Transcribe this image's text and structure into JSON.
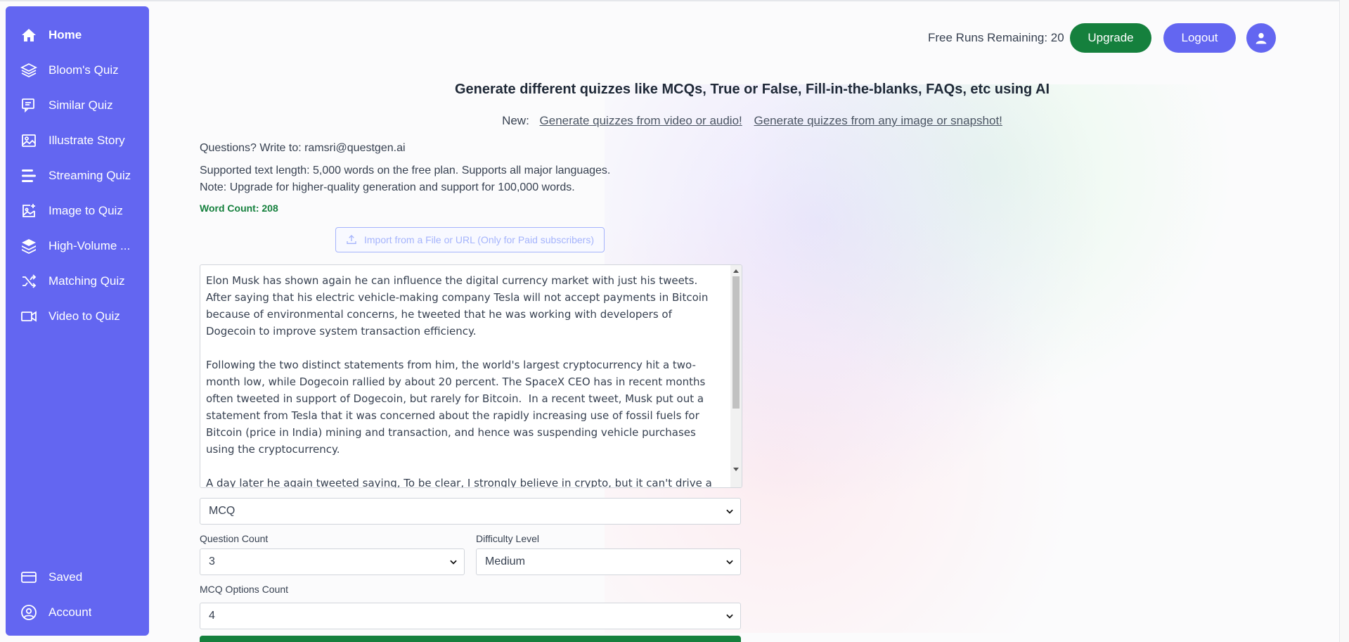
{
  "sidebar": {
    "items": [
      {
        "label": "Home",
        "icon": "home-icon"
      },
      {
        "label": "Bloom's Quiz",
        "icon": "layers-icon"
      },
      {
        "label": "Similar Quiz",
        "icon": "chat-icon"
      },
      {
        "label": "Illustrate Story",
        "icon": "image-icon"
      },
      {
        "label": "Streaming Quiz",
        "icon": "bars-icon"
      },
      {
        "label": "Image to Quiz",
        "icon": "image-plus-icon"
      },
      {
        "label": "High-Volume ...",
        "icon": "stack-icon"
      },
      {
        "label": "Matching Quiz",
        "icon": "shuffle-icon"
      },
      {
        "label": "Video to Quiz",
        "icon": "video-icon"
      }
    ],
    "bottom_items": [
      {
        "label": "Saved",
        "icon": "card-icon"
      },
      {
        "label": "Account",
        "icon": "user-circle-icon"
      }
    ]
  },
  "header": {
    "runs_remaining": "Free Runs Remaining: 20",
    "upgrade_label": "Upgrade",
    "logout_label": "Logout"
  },
  "main": {
    "title": "Generate different quizzes like MCQs, True or False, Fill-in-the-blanks, FAQs, etc using AI",
    "new_prefix": "New:",
    "new_link_video": "Generate quizzes from video or audio!",
    "new_link_image": "Generate quizzes from any image or snapshot!",
    "contact": "Questions? Write to: ramsri@questgen.ai",
    "supported_text": "Supported text length: 5,000 words on the free plan. Supports all major languages.",
    "note_text": "Note: Upgrade for higher-quality generation and support for 100,000 words.",
    "word_count": "Word Count: 208",
    "import_label": "Import from a File or URL (Only for Paid subscribers)",
    "input_text": "Elon Musk has shown again he can influence the digital currency market with just his tweets. After saying that his electric vehicle-making company Tesla will not accept payments in Bitcoin because of environmental concerns, he tweeted that he was working with developers of Dogecoin to improve system transaction efficiency.\n\nFollowing the two distinct statements from him, the world's largest cryptocurrency hit a two-month low, while Dogecoin rallied by about 20 percent. The SpaceX CEO has in recent months often tweeted in support of Dogecoin, but rarely for Bitcoin.  In a recent tweet, Musk put out a statement from Tesla that it was concerned about the rapidly increasing use of fossil fuels for Bitcoin (price in India) mining and transaction, and hence was suspending vehicle purchases using the cryptocurrency.\n\nA day later he again tweeted saying, To be clear, I strongly believe in crypto, but it can't drive a",
    "quiz_type": "MCQ",
    "question_count_label": "Question Count",
    "question_count": "3",
    "difficulty_label": "Difficulty Level",
    "difficulty": "Medium",
    "options_count_label": "MCQ Options Count",
    "options_count": "4"
  },
  "colors": {
    "primary": "#6366f1",
    "success": "#15803d"
  }
}
